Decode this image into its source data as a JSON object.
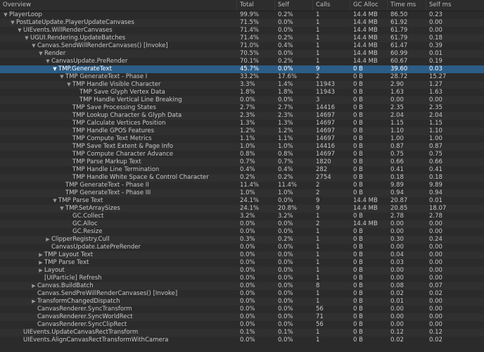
{
  "columns": [
    "Overview",
    "Total",
    "Self",
    "Calls",
    "GC Alloc",
    "Time ms",
    "Self ms"
  ],
  "rows": [
    {
      "depth": 0,
      "exp": "open",
      "name": "PlayerLoop",
      "total": "99.9%",
      "self": "0.2%",
      "calls": "1",
      "gc": "14.4 MB",
      "time": "86.50",
      "selfms": "0.23"
    },
    {
      "depth": 1,
      "exp": "open",
      "name": "PostLateUpdate.PlayerUpdateCanvases",
      "total": "71.5%",
      "self": "0.0%",
      "calls": "1",
      "gc": "14.4 MB",
      "time": "61.92",
      "selfms": "0.00"
    },
    {
      "depth": 2,
      "exp": "open",
      "name": "UIEvents.WillRenderCanvases",
      "total": "71.4%",
      "self": "0.0%",
      "calls": "1",
      "gc": "14.4 MB",
      "time": "61.79",
      "selfms": "0.00"
    },
    {
      "depth": 3,
      "exp": "open",
      "name": "UGUI.Rendering.UpdateBatches",
      "total": "71.4%",
      "self": "0.2%",
      "calls": "1",
      "gc": "14.4 MB",
      "time": "61.79",
      "selfms": "0.18"
    },
    {
      "depth": 4,
      "exp": "open",
      "name": "Canvas.SendWillRenderCanvases() [Invoke]",
      "total": "71.0%",
      "self": "0.4%",
      "calls": "1",
      "gc": "14.4 MB",
      "time": "61.47",
      "selfms": "0.39"
    },
    {
      "depth": 5,
      "exp": "open",
      "name": "Render",
      "total": "70.5%",
      "self": "0.0%",
      "calls": "1",
      "gc": "14.4 MB",
      "time": "60.99",
      "selfms": "0.01"
    },
    {
      "depth": 6,
      "exp": "open",
      "name": "CanvasUpdate.PreRender",
      "total": "70.1%",
      "self": "0.2%",
      "calls": "1",
      "gc": "14.4 MB",
      "time": "60.67",
      "selfms": "0.19"
    },
    {
      "depth": 7,
      "exp": "open",
      "name": "TMP.GenerateText",
      "total": "45.7%",
      "self": "0.0%",
      "calls": "9",
      "gc": "0 B",
      "time": "39.60",
      "selfms": "0.03",
      "selected": true
    },
    {
      "depth": 8,
      "exp": "open",
      "name": "TMP GenerateText - Phase I",
      "total": "33.2%",
      "self": "17.6%",
      "calls": "2",
      "gc": "0 B",
      "time": "28.72",
      "selfms": "15.27"
    },
    {
      "depth": 9,
      "exp": "open",
      "name": "TMP Handle Visible Character",
      "total": "3.3%",
      "self": "1.4%",
      "calls": "11943",
      "gc": "0 B",
      "time": "2.90",
      "selfms": "1.27"
    },
    {
      "depth": 10,
      "exp": "",
      "name": "TMP Save Glyph Vertex Data",
      "total": "1.8%",
      "self": "1.8%",
      "calls": "11943",
      "gc": "0 B",
      "time": "1.63",
      "selfms": "1.63"
    },
    {
      "depth": 10,
      "exp": "",
      "name": "TMP Handle Vertical Line Breaking",
      "total": "0.0%",
      "self": "0.0%",
      "calls": "3",
      "gc": "0 B",
      "time": "0.00",
      "selfms": "0.00"
    },
    {
      "depth": 9,
      "exp": "",
      "name": "TMP Save Processing States",
      "total": "2.7%",
      "self": "2.7%",
      "calls": "14416",
      "gc": "0 B",
      "time": "2.35",
      "selfms": "2.35"
    },
    {
      "depth": 9,
      "exp": "",
      "name": "TMP Lookup Character & Glyph Data",
      "total": "2.3%",
      "self": "2.3%",
      "calls": "14697",
      "gc": "0 B",
      "time": "2.04",
      "selfms": "2.04"
    },
    {
      "depth": 9,
      "exp": "",
      "name": "TMP Calculate Vertices Position",
      "total": "1.3%",
      "self": "1.3%",
      "calls": "14697",
      "gc": "0 B",
      "time": "1.15",
      "selfms": "1.15"
    },
    {
      "depth": 9,
      "exp": "",
      "name": "TMP Handle GPOS Features",
      "total": "1.2%",
      "self": "1.2%",
      "calls": "14697",
      "gc": "0 B",
      "time": "1.10",
      "selfms": "1.10"
    },
    {
      "depth": 9,
      "exp": "",
      "name": "TMP Compute Text Metrics",
      "total": "1.1%",
      "self": "1.1%",
      "calls": "14697",
      "gc": "0 B",
      "time": "1.00",
      "selfms": "1.00"
    },
    {
      "depth": 9,
      "exp": "",
      "name": "TMP Save Text Extent & Page Info",
      "total": "1.0%",
      "self": "1.0%",
      "calls": "14416",
      "gc": "0 B",
      "time": "0.87",
      "selfms": "0.87"
    },
    {
      "depth": 9,
      "exp": "",
      "name": "TMP Compute Character Advance",
      "total": "0.8%",
      "self": "0.8%",
      "calls": "14697",
      "gc": "0 B",
      "time": "0.75",
      "selfms": "0.75"
    },
    {
      "depth": 9,
      "exp": "",
      "name": "TMP Parse Markup Text",
      "total": "0.7%",
      "self": "0.7%",
      "calls": "1820",
      "gc": "0 B",
      "time": "0.66",
      "selfms": "0.66"
    },
    {
      "depth": 9,
      "exp": "",
      "name": "TMP Handle Line Termination",
      "total": "0.4%",
      "self": "0.4%",
      "calls": "282",
      "gc": "0 B",
      "time": "0.41",
      "selfms": "0.41"
    },
    {
      "depth": 9,
      "exp": "",
      "name": "TMP Handle White Space & Control Character",
      "total": "0.2%",
      "self": "0.2%",
      "calls": "2754",
      "gc": "0 B",
      "time": "0.18",
      "selfms": "0.18"
    },
    {
      "depth": 8,
      "exp": "",
      "name": "TMP GenerateText - Phase II",
      "total": "11.4%",
      "self": "11.4%",
      "calls": "2",
      "gc": "0 B",
      "time": "9.89",
      "selfms": "9.89"
    },
    {
      "depth": 8,
      "exp": "",
      "name": "TMP GenerateText - Phase III",
      "total": "1.0%",
      "self": "1.0%",
      "calls": "2",
      "gc": "0 B",
      "time": "0.94",
      "selfms": "0.94"
    },
    {
      "depth": 7,
      "exp": "open",
      "name": "TMP Parse Text",
      "total": "24.1%",
      "self": "0.0%",
      "calls": "9",
      "gc": "14.4 MB",
      "time": "20.87",
      "selfms": "0.01"
    },
    {
      "depth": 8,
      "exp": "open",
      "name": "TMP.SetArraySizes",
      "total": "24.1%",
      "self": "20.8%",
      "calls": "9",
      "gc": "14.4 MB",
      "time": "20.85",
      "selfms": "18.07"
    },
    {
      "depth": 9,
      "exp": "",
      "name": "GC.Collect",
      "total": "3.2%",
      "self": "3.2%",
      "calls": "1",
      "gc": "0 B",
      "time": "2.78",
      "selfms": "2.78"
    },
    {
      "depth": 9,
      "exp": "",
      "name": "GC.Alloc",
      "total": "0.0%",
      "self": "0.0%",
      "calls": "2",
      "gc": "14.4 MB",
      "time": "0.00",
      "selfms": "0.00"
    },
    {
      "depth": 9,
      "exp": "",
      "name": "GC.Resize",
      "total": "0.0%",
      "self": "0.0%",
      "calls": "1",
      "gc": "0 B",
      "time": "0.00",
      "selfms": "0.00"
    },
    {
      "depth": 6,
      "exp": "closed",
      "name": "ClipperRegistry.Cull",
      "total": "0.3%",
      "self": "0.2%",
      "calls": "1",
      "gc": "0 B",
      "time": "0.30",
      "selfms": "0.24"
    },
    {
      "depth": 6,
      "exp": "",
      "name": "CanvasUpdate.LatePreRender",
      "total": "0.0%",
      "self": "0.0%",
      "calls": "1",
      "gc": "0 B",
      "time": "0.00",
      "selfms": "0.00"
    },
    {
      "depth": 5,
      "exp": "closed",
      "name": "TMP Layout Text",
      "total": "0.0%",
      "self": "0.0%",
      "calls": "1",
      "gc": "0 B",
      "time": "0.04",
      "selfms": "0.00"
    },
    {
      "depth": 5,
      "exp": "closed",
      "name": "TMP Parse Text",
      "total": "0.0%",
      "self": "0.0%",
      "calls": "1",
      "gc": "0 B",
      "time": "0.03",
      "selfms": "0.00"
    },
    {
      "depth": 5,
      "exp": "closed",
      "name": "Layout",
      "total": "0.0%",
      "self": "0.0%",
      "calls": "1",
      "gc": "0 B",
      "time": "0.00",
      "selfms": "0.00"
    },
    {
      "depth": 5,
      "exp": "",
      "name": "[UIParticle] Refresh",
      "total": "0.0%",
      "self": "0.0%",
      "calls": "1",
      "gc": "0 B",
      "time": "0.00",
      "selfms": "0.00"
    },
    {
      "depth": 4,
      "exp": "closed",
      "name": "Canvas.BuildBatch",
      "total": "0.0%",
      "self": "0.0%",
      "calls": "8",
      "gc": "0 B",
      "time": "0.08",
      "selfms": "0.07"
    },
    {
      "depth": 4,
      "exp": "",
      "name": "Canvas.SendPreWillRenderCanvases() [Invoke]",
      "total": "0.0%",
      "self": "0.0%",
      "calls": "1",
      "gc": "0 B",
      "time": "0.02",
      "selfms": "0.02"
    },
    {
      "depth": 4,
      "exp": "closed",
      "name": "TransformChangedDispatch",
      "total": "0.0%",
      "self": "0.0%",
      "calls": "1",
      "gc": "0 B",
      "time": "0.01",
      "selfms": "0.00"
    },
    {
      "depth": 4,
      "exp": "",
      "name": "CanvasRenderer.SyncTransform",
      "total": "0.0%",
      "self": "0.0%",
      "calls": "56",
      "gc": "0 B",
      "time": "0.00",
      "selfms": "0.00"
    },
    {
      "depth": 4,
      "exp": "",
      "name": "CanvasRenderer.SyncWorldRect",
      "total": "0.0%",
      "self": "0.0%",
      "calls": "71",
      "gc": "0 B",
      "time": "0.00",
      "selfms": "0.00"
    },
    {
      "depth": 4,
      "exp": "",
      "name": "CanvasRenderer.SyncClipRect",
      "total": "0.0%",
      "self": "0.0%",
      "calls": "56",
      "gc": "0 B",
      "time": "0.00",
      "selfms": "0.00"
    },
    {
      "depth": 2,
      "exp": "",
      "name": "UIEvents.UpdateCanvasRectTransform",
      "total": "0.1%",
      "self": "0.1%",
      "calls": "1",
      "gc": "0 B",
      "time": "0.12",
      "selfms": "0.12"
    },
    {
      "depth": 2,
      "exp": "",
      "name": "UIEvents.AlignCanvasRectTransformWithCamera",
      "total": "0.0%",
      "self": "0.0%",
      "calls": "1",
      "gc": "0 B",
      "time": "0.02",
      "selfms": "0.02"
    }
  ]
}
